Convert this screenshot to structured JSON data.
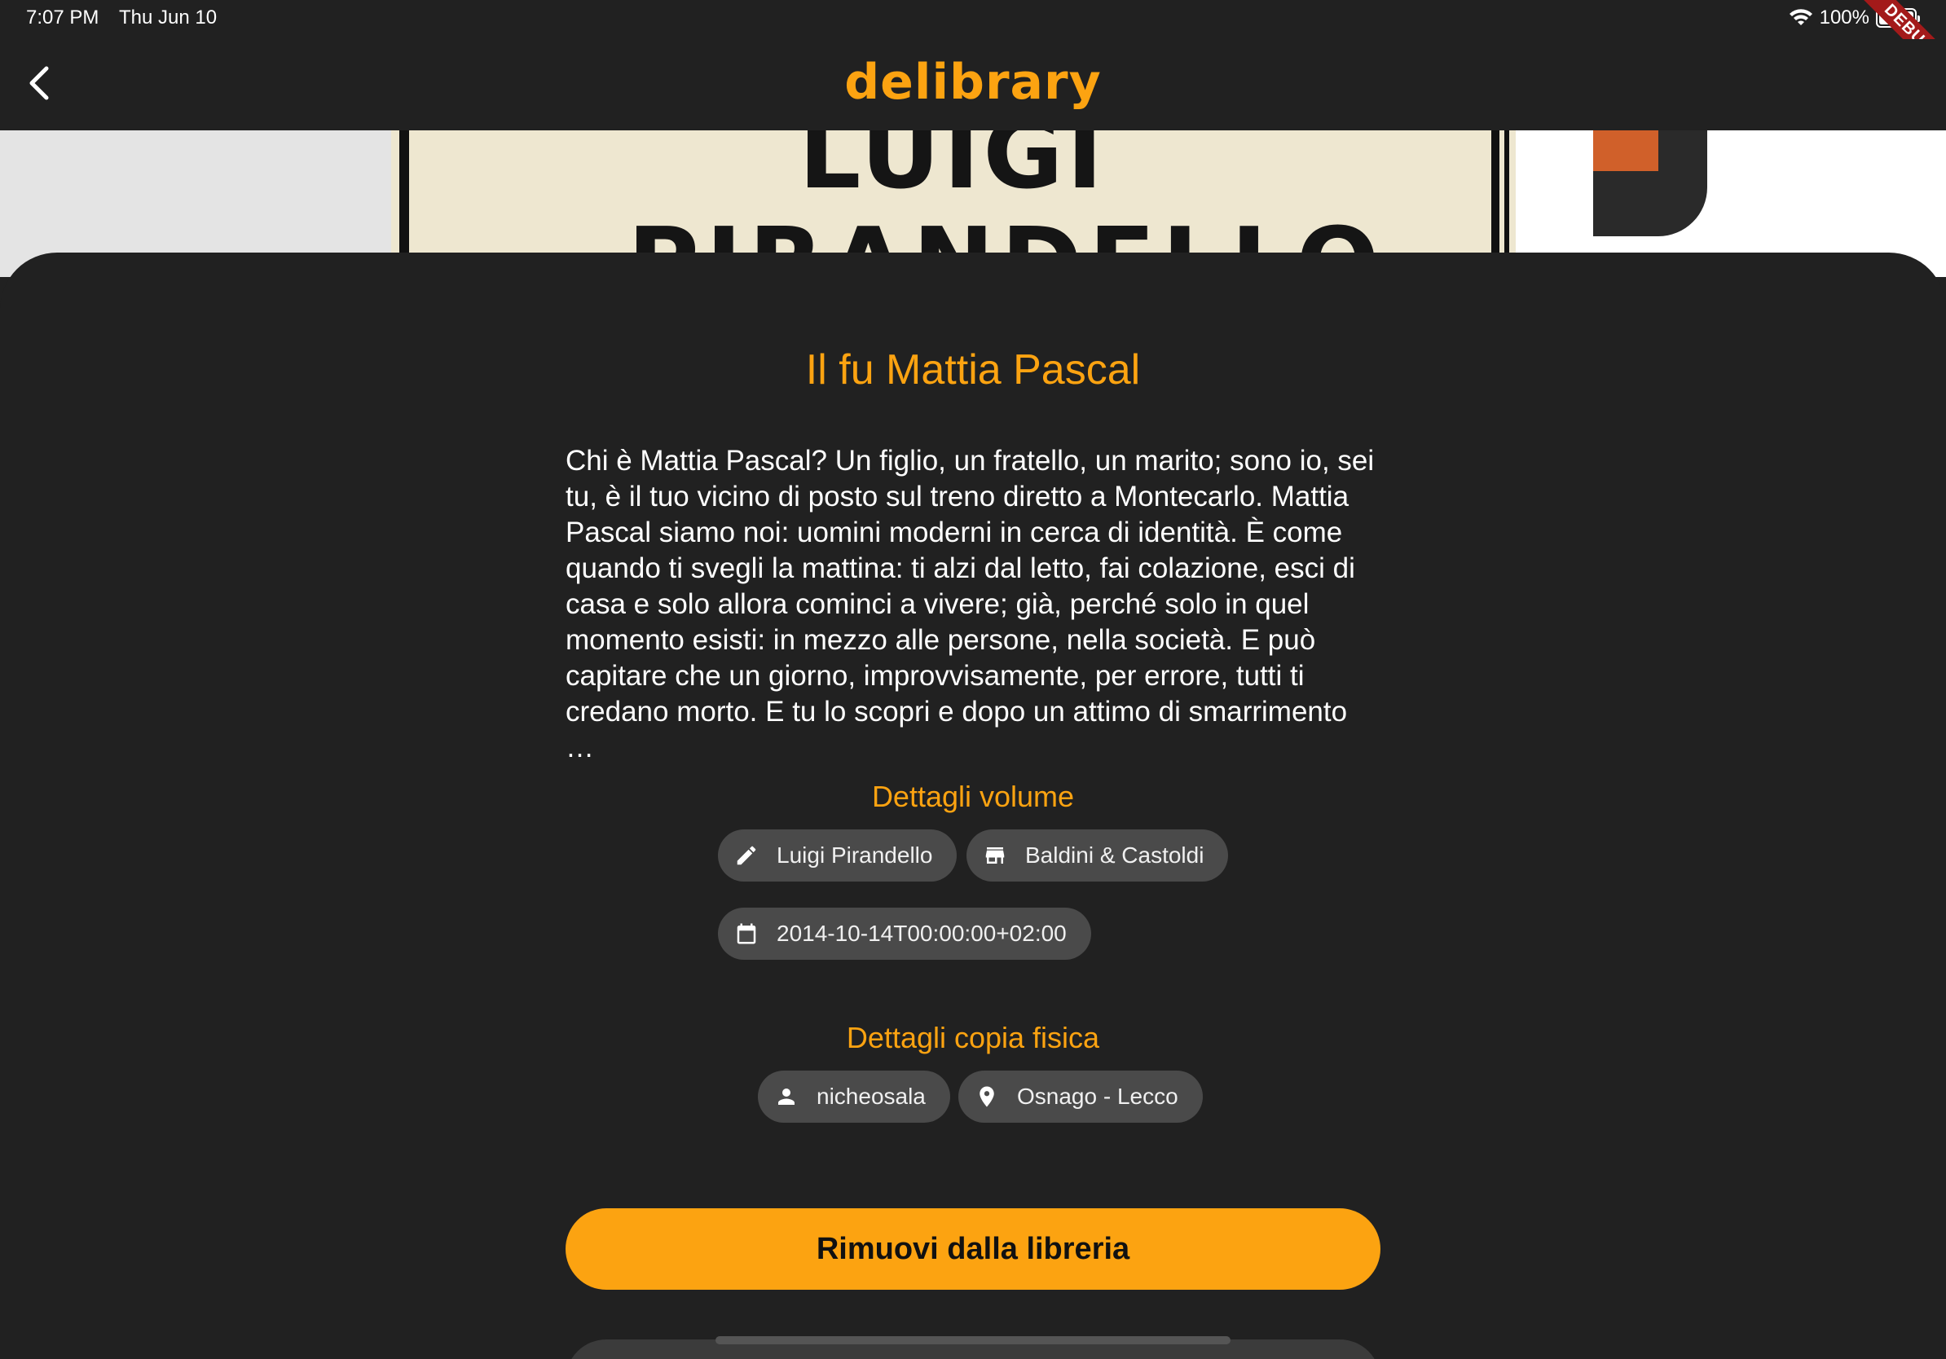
{
  "status_bar": {
    "time": "7:07 PM",
    "date": "Thu Jun 10",
    "battery": "100%"
  },
  "debug_banner": "DEBUG",
  "app_bar": {
    "title": "delibrary"
  },
  "cover": {
    "author_line1": "LUIGI",
    "author_line2": "PIRANDELLO"
  },
  "book": {
    "title": "Il fu Mattia Pascal",
    "description": "Chi è Mattia Pascal? Un figlio, un fratello, un marito; sono io, sei tu, è il tuo vicino di posto sul treno diretto a Montecarlo. Mattia Pascal siamo noi: uomini moderni in cerca di identità. È come quando ti svegli la mattina: ti alzi dal letto, fai colazione, esci di casa e solo allora cominci a vivere; già, perché solo in quel momento esisti: in mezzo alle persone, nella società. E può capitare che un giorno, improvvisamente, per errore, tutti ti credano morto. E tu lo scopri e dopo un attimo di smarrimento …"
  },
  "volume_details": {
    "title": "Dettagli volume",
    "author": "Luigi Pirandello",
    "publisher": "Baldini & Castoldi",
    "published_date": "2014-10-14T00:00:00+02:00"
  },
  "copy_details": {
    "title": "Dettagli copia fisica",
    "owner": "nicheosala",
    "location": "Osnago - Lecco"
  },
  "actions": {
    "remove_label": "Rimuovi dalla libreria"
  },
  "colors": {
    "accent": "#fca311",
    "background": "#212121",
    "chip": "#4a4a4a"
  },
  "icons": {
    "back": "chevron-left-icon",
    "author": "pencil-icon",
    "publisher": "store-icon",
    "date": "calendar-icon",
    "owner": "person-icon",
    "location": "location-pin-icon"
  }
}
